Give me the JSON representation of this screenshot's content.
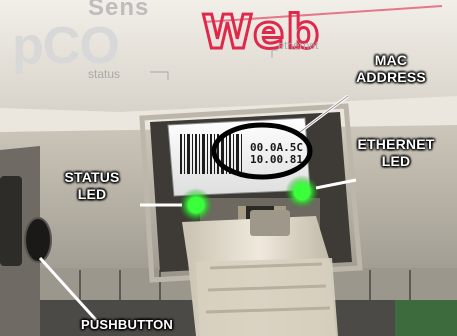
{
  "labels": {
    "mac_address": [
      "MAC",
      "ADDRESS"
    ],
    "ethernet_led": [
      "ETHERNET",
      "LED"
    ],
    "status_led": [
      "STATUS",
      "LED"
    ],
    "pushbutton": "PUSHBUTTON"
  },
  "device_print": {
    "brand_top": "Sens",
    "brand_left": "pCO",
    "brand_right": "Web",
    "status_tag": "status",
    "ethernet_tag": "ethernet",
    "mac_line1": "00.0A.5C",
    "mac_line2": "10.00.81"
  },
  "colors": {
    "led_green": "#3cff3c",
    "brand_red": "#e0284a",
    "housing": "#d9d5cc",
    "label_text": "#ffffff",
    "callout_ring": "#000000"
  }
}
